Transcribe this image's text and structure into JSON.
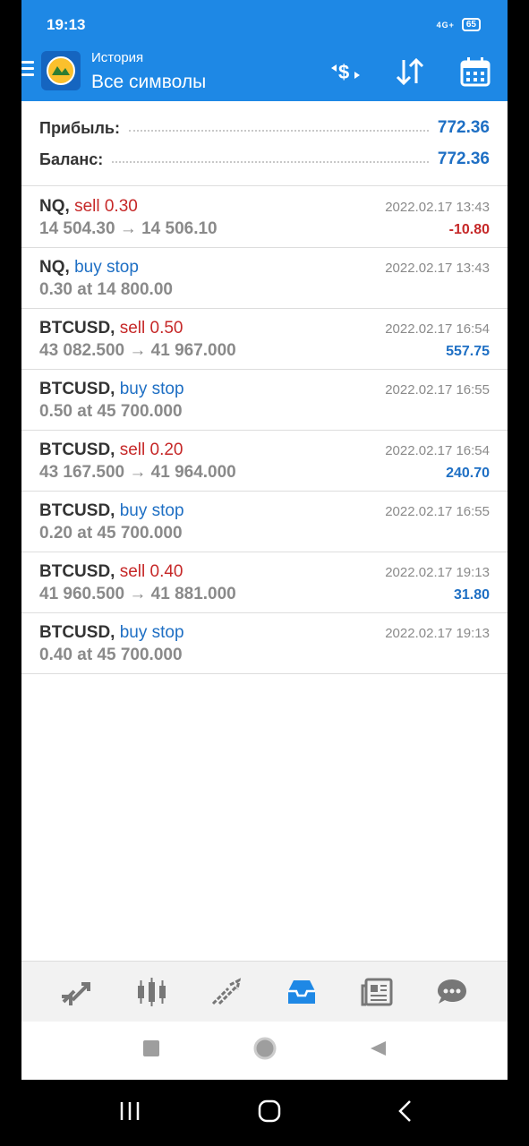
{
  "status": {
    "time": "19:13",
    "signal": "4G+",
    "battery": "65"
  },
  "header": {
    "subtitle": "История",
    "title": "Все символы"
  },
  "summary": {
    "profit_label": "Прибыль:",
    "profit_value": "772.36",
    "balance_label": "Баланс:",
    "balance_value": "772.36"
  },
  "rows": [
    {
      "symbol": "NQ,",
      "action": "sell 0.30",
      "type": "sell",
      "detail": "14 504.30 → 14 506.10",
      "time": "2022.02.17 13:43",
      "profit": "-10.80",
      "profit_sign": "neg"
    },
    {
      "symbol": "NQ,",
      "action": "buy stop",
      "type": "buy",
      "detail": "0.30 at 14 800.00",
      "time": "2022.02.17 13:43",
      "profit": "",
      "profit_sign": ""
    },
    {
      "symbol": "BTCUSD,",
      "action": "sell 0.50",
      "type": "sell",
      "detail": "43 082.500 → 41 967.000",
      "time": "2022.02.17 16:54",
      "profit": "557.75",
      "profit_sign": "pos"
    },
    {
      "symbol": "BTCUSD,",
      "action": "buy stop",
      "type": "buy",
      "detail": "0.50 at 45 700.000",
      "time": "2022.02.17 16:55",
      "profit": "",
      "profit_sign": ""
    },
    {
      "symbol": "BTCUSD,",
      "action": "sell 0.20",
      "type": "sell",
      "detail": "43 167.500 → 41 964.000",
      "time": "2022.02.17 16:54",
      "profit": "240.70",
      "profit_sign": "pos"
    },
    {
      "symbol": "BTCUSD,",
      "action": "buy stop",
      "type": "buy",
      "detail": "0.20 at 45 700.000",
      "time": "2022.02.17 16:55",
      "profit": "",
      "profit_sign": ""
    },
    {
      "symbol": "BTCUSD,",
      "action": "sell 0.40",
      "type": "sell",
      "detail": "41 960.500 → 41 881.000",
      "time": "2022.02.17 19:13",
      "profit": "31.80",
      "profit_sign": "pos"
    },
    {
      "symbol": "BTCUSD,",
      "action": "buy stop",
      "type": "buy",
      "detail": "0.40 at 45 700.000",
      "time": "2022.02.17 19:13",
      "profit": "",
      "profit_sign": ""
    }
  ],
  "tabs": [
    {
      "name": "tab-quotes",
      "icon": "quotes-icon"
    },
    {
      "name": "tab-chart",
      "icon": "candlestick-icon"
    },
    {
      "name": "tab-trade",
      "icon": "trade-icon"
    },
    {
      "name": "tab-history",
      "icon": "inbox-icon",
      "active": true
    },
    {
      "name": "tab-news",
      "icon": "news-icon"
    },
    {
      "name": "tab-messages",
      "icon": "chat-icon"
    }
  ],
  "colors": {
    "accent": "#1e88e5",
    "sell": "#c62828",
    "buy": "#1e6fc4",
    "muted": "#8a8a8a"
  }
}
